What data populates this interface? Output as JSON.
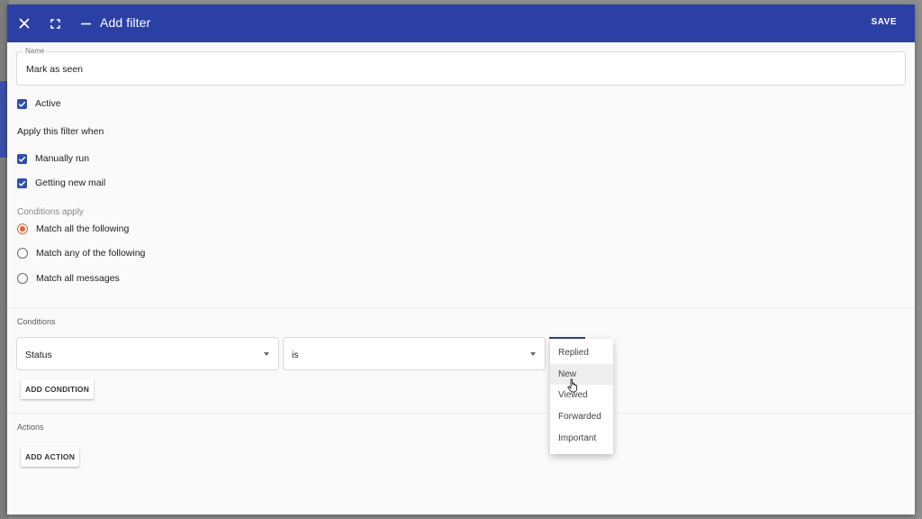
{
  "dialog": {
    "title": "Add filter",
    "save_label": "SAVE"
  },
  "name_field": {
    "label": "Name",
    "value": "Mark as seen"
  },
  "active": {
    "label": "Active",
    "checked": true
  },
  "apply_when": {
    "heading": "Apply this filter when",
    "options": [
      {
        "label": "Manually run",
        "checked": true
      },
      {
        "label": "Getting new mail",
        "checked": true
      }
    ]
  },
  "conditions_apply": {
    "heading": "Conditions apply",
    "options": [
      {
        "label": "Match all the following",
        "selected": true
      },
      {
        "label": "Match any of the following",
        "selected": false
      },
      {
        "label": "Match all messages",
        "selected": false
      }
    ]
  },
  "conditions": {
    "heading": "Conditions",
    "field_select": "Status",
    "operator_select": "is",
    "add_label": "ADD CONDITION"
  },
  "dropdown": {
    "items": [
      "Replied",
      "New",
      "Viewed",
      "Forwarded",
      "Important"
    ],
    "hovered_index": 1
  },
  "actions": {
    "heading": "Actions",
    "add_label": "ADD ACTION"
  },
  "colors": {
    "toolbar": "#2a40a5",
    "checkbox": "#2f4eb0",
    "radio_selected": "#e8632b"
  }
}
